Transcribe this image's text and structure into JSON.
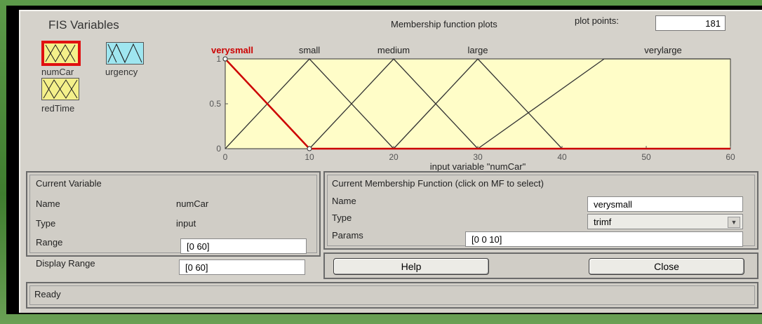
{
  "fis": {
    "title": "FIS Variables",
    "variables": [
      {
        "name": "numCar",
        "selected": true
      },
      {
        "name": "urgency",
        "selected": false
      },
      {
        "name": "redTime",
        "selected": false
      }
    ]
  },
  "plot_header": {
    "title": "Membership function plots",
    "plot_points_label": "plot points:",
    "plot_points_value": "181"
  },
  "chart_data": {
    "type": "line",
    "xlabel": "input variable \"numCar\"",
    "xlim": [
      0,
      60
    ],
    "ylim": [
      0,
      1
    ],
    "x_ticks": [
      0,
      10,
      20,
      30,
      40,
      50,
      60
    ],
    "y_ticks": [
      0,
      0.5,
      1
    ],
    "x_tick_labels": [
      "0",
      "10",
      "20",
      "30",
      "40",
      "50",
      "60"
    ],
    "y_tick_labels": [
      "0",
      "0.5",
      "1"
    ],
    "series": [
      {
        "name": "verysmall",
        "x": [
          0,
          0,
          10
        ],
        "y": [
          1,
          1,
          0
        ],
        "color": "#cc0000",
        "selected": true
      },
      {
        "name": "small",
        "x": [
          0,
          10,
          20
        ],
        "y": [
          0,
          1,
          0
        ],
        "color": "#333333",
        "selected": false
      },
      {
        "name": "medium",
        "x": [
          10,
          20,
          30
        ],
        "y": [
          0,
          1,
          0
        ],
        "color": "#333333",
        "selected": false
      },
      {
        "name": "large",
        "x": [
          20,
          30,
          40
        ],
        "y": [
          0,
          1,
          0
        ],
        "color": "#333333",
        "selected": false
      },
      {
        "name": "verylarge",
        "x": [
          30,
          45,
          60
        ],
        "y": [
          0,
          1,
          1
        ],
        "color": "#333333",
        "selected": false
      }
    ],
    "plot_background": "#fffdc8"
  },
  "current_variable": {
    "title": "Current Variable",
    "name_label": "Name",
    "name_value": "numCar",
    "type_label": "Type",
    "type_value": "input",
    "range_label": "Range",
    "range_value": "[0 60]",
    "display_range_label": "Display Range",
    "display_range_value": "[0 60]"
  },
  "current_mf": {
    "title": "Current Membership Function (click on MF to select)",
    "name_label": "Name",
    "name_value": "verysmall",
    "type_label": "Type",
    "type_value": "trimf",
    "params_label": "Params",
    "params_value": "[0 0 10]"
  },
  "buttons": {
    "help": "Help",
    "close": "Close"
  },
  "status": {
    "text": "Ready"
  },
  "colors": {
    "selected_border": "#e01010",
    "icon_yellow": "#f4f08a",
    "icon_cyan": "#9fe6f0",
    "window_bg": "#d5d2cb"
  }
}
